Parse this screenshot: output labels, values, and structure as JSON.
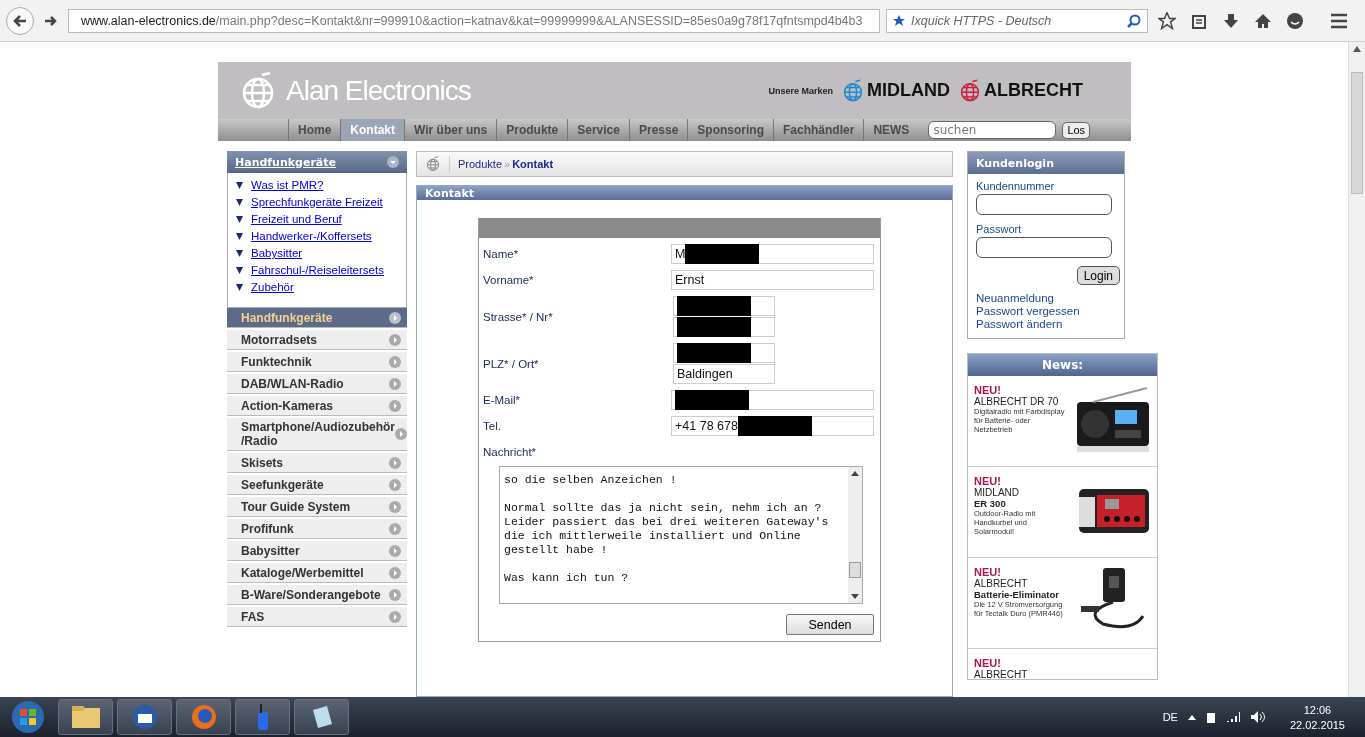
{
  "browser": {
    "url_host": "www.alan-electronics.de",
    "url_path": "/main.php?desc=Kontakt&nr=999910&action=katnav&kat=99999999&ALANSESSID=85es0a9g78f17qfntsmpd4b4b3",
    "search_placeholder": "Ixquick HTTPS - Deutsch"
  },
  "header": {
    "logo": "Alan Electronics",
    "brands_label": "Unsere Marken",
    "brands": [
      "MIDLAND",
      "ALBRECHT"
    ]
  },
  "nav": [
    {
      "label": "Home",
      "selected": false
    },
    {
      "label": "Kontakt",
      "selected": true
    },
    {
      "label": "Wir über uns",
      "selected": false
    },
    {
      "label": "Produkte",
      "selected": false
    },
    {
      "label": "Service",
      "selected": false
    },
    {
      "label": "Presse",
      "selected": false
    },
    {
      "label": "Sponsoring",
      "selected": false
    },
    {
      "label": "Fachhändler",
      "selected": false
    },
    {
      "label": "NEWS",
      "selected": false
    }
  ],
  "site_search": {
    "placeholder": "suchen",
    "button": "Los"
  },
  "sidebar": {
    "title": "Handfunkgeräte",
    "links": [
      "Was ist PMR?",
      "Sprechfunkgeräte Freizeit",
      "Freizeit und Beruf",
      "Handwerker-/Koffersets",
      "Babysitter",
      "Fahrschul-/Reiseleitersets",
      "Zubehör"
    ],
    "categories": [
      {
        "label": "Handfunkgeräte",
        "selected": true
      },
      {
        "label": "Motorradsets",
        "selected": false
      },
      {
        "label": "Funktechnik",
        "selected": false
      },
      {
        "label": "DAB/WLAN-Radio",
        "selected": false
      },
      {
        "label": "Action-Kameras",
        "selected": false
      },
      {
        "label": "Smartphone/Audiozubehör /Radio",
        "selected": false
      },
      {
        "label": "Skisets",
        "selected": false
      },
      {
        "label": "Seefunkgeräte",
        "selected": false
      },
      {
        "label": "Tour Guide System",
        "selected": false
      },
      {
        "label": "Profifunk",
        "selected": false
      },
      {
        "label": "Babysitter",
        "selected": false
      },
      {
        "label": "Kataloge/Werbemittel",
        "selected": false
      },
      {
        "label": "B-Ware/Sonderangebote",
        "selected": false
      },
      {
        "label": "FAS",
        "selected": false
      }
    ]
  },
  "breadcrumb": {
    "items": [
      "Produkte",
      "Kontakt"
    ],
    "separator": "»"
  },
  "form": {
    "title": "Kontakt",
    "rows": [
      {
        "label": "Name*",
        "fields": [
          {
            "value": "M",
            "redacted": true
          }
        ]
      },
      {
        "label": "Vorname*",
        "fields": [
          {
            "value": "Ernst",
            "redacted": false
          }
        ]
      },
      {
        "label": "Strasse* / Nr*",
        "fields": [
          {
            "redacted": true
          },
          {
            "redacted": true
          }
        ]
      },
      {
        "label": "PLZ* / Ort*",
        "fields": [
          {
            "redacted": true
          },
          {
            "value": "Baldingen",
            "redacted": false
          }
        ]
      },
      {
        "label": "E-Mail*",
        "fields": [
          {
            "redacted": true
          }
        ]
      },
      {
        "label": "Tel.",
        "fields": [
          {
            "value": "+41 78 678",
            "redacted": true
          }
        ]
      }
    ],
    "message_label": "Nachricht*",
    "message": "so die selben Anzeichen !\n\nNormal sollte das ja nicht sein, nehm ich an ?\nLeider passiert das bei drei weiteren Gateway's\ndie ich mittlerweile installiert und Online\ngestellt habe !\n\nWas kann ich tun ?",
    "submit": "Senden"
  },
  "login": {
    "title": "Kundenlogin",
    "customer_label": "Kundennummer",
    "password_label": "Passwort",
    "button": "Login",
    "links": [
      "Neuanmeldung",
      "Passwort vergessen",
      "Passwort ändern"
    ]
  },
  "news": {
    "title": "News:",
    "items": [
      {
        "badge": "NEU!",
        "brand": "ALBRECHT DR 70",
        "desc": "Digitalradio mit Farbdisplay für Batterie- oder Netzbetrieb",
        "kind": "radio"
      },
      {
        "badge": "NEU!",
        "brand": "MIDLAND",
        "product": "ER 300",
        "desc": "Outdoor-Radio mit Handkurbel und Solarmodul!",
        "kind": "crank"
      },
      {
        "badge": "NEU!",
        "brand": "ALBRECHT",
        "product": "Batterie-Eliminator",
        "desc": "Die 12 V Stromversorgung für Tectalk Duro (PMR446)",
        "kind": "adapter"
      },
      {
        "badge": "NEU!",
        "brand": "ALBRECHT",
        "kind": "none"
      }
    ]
  },
  "taskbar": {
    "language": "DE",
    "time": "12:06",
    "date": "22.02.2015"
  }
}
